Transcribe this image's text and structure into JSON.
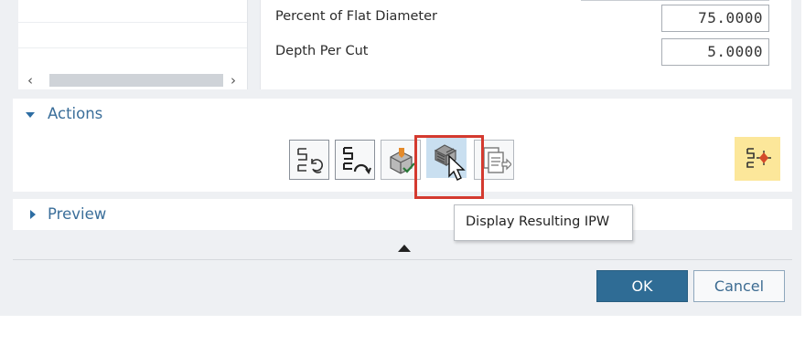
{
  "parameters": [
    {
      "label": "Percent of Flat Diameter",
      "value": "75.0000"
    },
    {
      "label": "Depth Per Cut",
      "value": "5.0000"
    }
  ],
  "scrollbar": {
    "left_arrow": "‹",
    "right_arrow": "›"
  },
  "actions": {
    "title": "Actions",
    "tools": [
      {
        "name": "generate-icon"
      },
      {
        "name": "replay-icon"
      },
      {
        "name": "verify-icon"
      },
      {
        "name": "display-ipw-icon"
      },
      {
        "name": "list-icon"
      }
    ],
    "tooltip": "Display Resulting IPW",
    "highlight_color": "#d43a2f"
  },
  "preview": {
    "title": "Preview"
  },
  "footer": {
    "ok_label": "OK",
    "cancel_label": "Cancel"
  },
  "colors": {
    "accent": "#2f6c95",
    "section_title": "#3a6e9a",
    "yellow_button": "#fce79a"
  }
}
